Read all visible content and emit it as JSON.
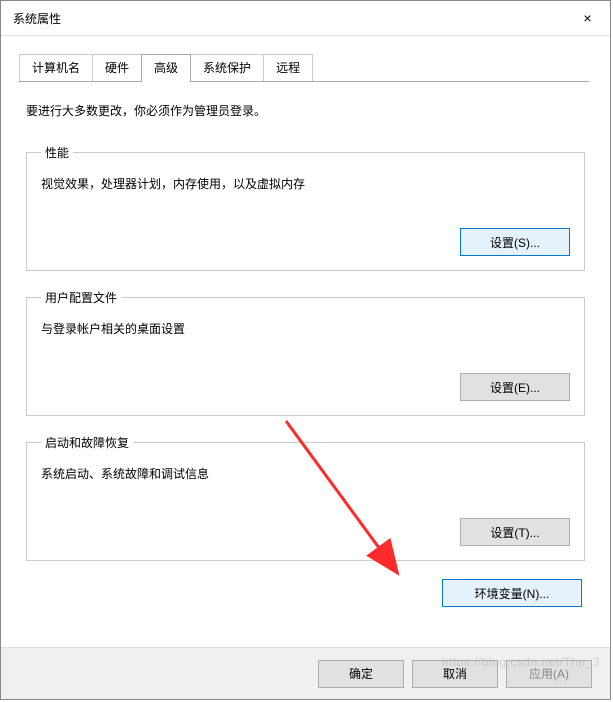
{
  "window": {
    "title": "系统属性",
    "close_label": "×"
  },
  "tabs": {
    "t0": "计算机名",
    "t1": "硬件",
    "t2": "高级",
    "t3": "系统保护",
    "t4": "远程"
  },
  "intro": "要进行大多数更改，你必须作为管理员登录。",
  "groups": {
    "performance": {
      "legend": "性能",
      "text": "视觉效果，处理器计划，内存使用，以及虚拟内存",
      "button": "设置(S)..."
    },
    "profiles": {
      "legend": "用户配置文件",
      "text": "与登录帐户相关的桌面设置",
      "button": "设置(E)..."
    },
    "startup": {
      "legend": "启动和故障恢复",
      "text": "系统启动、系统故障和调试信息",
      "button": "设置(T)..."
    }
  },
  "env_button": "环境变量(N)...",
  "bottom": {
    "ok": "确定",
    "cancel": "取消",
    "apply": "应用(A)"
  },
  "watermark": "https://blog.csdn.net/The_3"
}
